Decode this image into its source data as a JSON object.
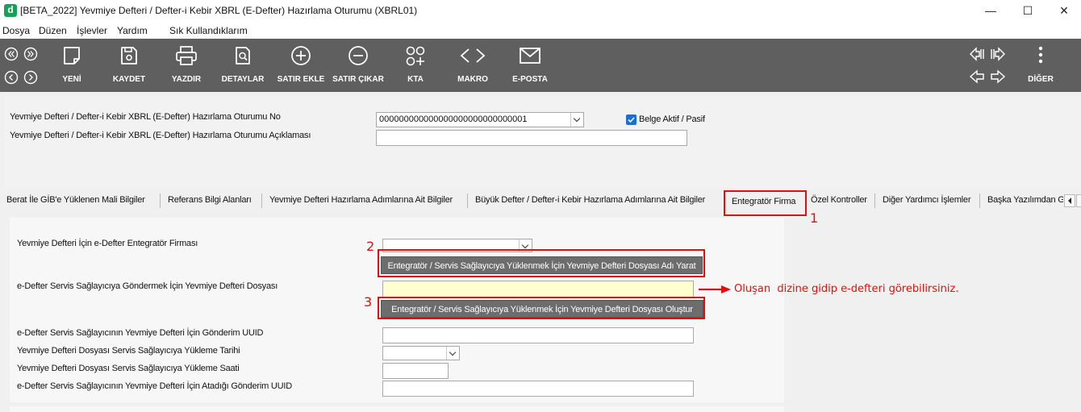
{
  "window": {
    "title": "[BETA_2022] Yevmiye Defteri / Defter-i Kebir XBRL (E-Defter) Hazırlama Oturumu (XBRL01)",
    "logo": "d",
    "minimize": "—",
    "maximize": "☐",
    "close": "✕"
  },
  "menu": {
    "items": [
      "Dosya",
      "Düzen",
      "İşlevler",
      "Yardım",
      "Sık Kullandıklarım"
    ]
  },
  "toolbar": {
    "buttons": [
      {
        "label": "YENİ",
        "icon": "new-document-icon"
      },
      {
        "label": "KAYDET",
        "icon": "save-icon"
      },
      {
        "label": "YAZDIR",
        "icon": "printer-icon"
      },
      {
        "label": "DETAYLAR",
        "icon": "details-icon"
      },
      {
        "label": "SATIR EKLE",
        "icon": "plus-circle-icon"
      },
      {
        "label": "SATIR ÇIKAR",
        "icon": "minus-circle-icon"
      },
      {
        "label": "KTA",
        "icon": "kta-icon"
      },
      {
        "label": "MAKRO",
        "icon": "code-icon"
      },
      {
        "label": "E-POSTA",
        "icon": "mail-icon"
      },
      {
        "label": "DİĞER",
        "icon": "more-vertical-icon"
      }
    ]
  },
  "header": {
    "session_no_label": "Yevmiye Defteri / Defter-i Kebir XBRL (E-Defter) Hazırlama Oturumu No",
    "session_no_value": "000000000000000000000000000001",
    "session_desc_label": "Yevmiye Defteri / Defter-i Kebir XBRL (E-Defter) Hazırlama Oturumu Açıklaması",
    "session_desc_value": "",
    "active_label": "Belge Aktif / Pasif",
    "active_checked": true
  },
  "tabs": [
    "Berat İle GİB'e Yüklenen Mali Bilgiler",
    "Referans Bilgi Alanları",
    "Yevmiye Defteri Hazırlama Adımlarına Ait Bilgiler",
    "Büyük Defter / Defter-i Kebir Hazırlama Adımlarına Ait Bilgiler",
    "Entegratör Firma",
    "Özel Kontroller",
    "Diğer Yardımcı İşlemler",
    "Başka Yazılımdan G"
  ],
  "active_tab": "Entegratör Firma",
  "form": {
    "integrator_label": "Yevmiye Defteri İçin e-Defter Entegratör Firması",
    "integrator_value": "",
    "create_name_button": "Entegratör / Servis Sağlayıcıya Yüklenmek İçin Yevmiye Defteri Dosyası Adı Yarat",
    "file_label": "e-Defter Servis Sağlayıcıya Göndermek İçin Yevmiye Defteri Dosyası",
    "file_value": "",
    "create_file_button": "Entegratör / Servis Sağlayıcıya Yüklenmek İçin Yevmiye Defteri Dosyası Oluştur",
    "uuid_label": "e-Defter Servis Sağlayıcının Yevmiye Defteri İçin Gönderim UUID",
    "uuid_value": "",
    "upload_date_label": "Yevmiye Defteri Dosyası Servis Sağlayıcıya Yükleme Tarihi",
    "upload_date_value": "",
    "upload_time_label": "Yevmiye Defteri Dosyası Servis Sağlayıcıya Yükleme Saati",
    "upload_time_value": "",
    "assigned_uuid_label": "e-Defter Servis Sağlayıcının Yevmiye Defteri İçin Atadığı Gönderim UUID",
    "assigned_uuid_value": ""
  },
  "annotations": {
    "n1": "1",
    "n2": "2",
    "n3": "3",
    "note": "Oluşan  dizine gidip e-defteri görebilirsiniz.",
    "color": "#e01010"
  }
}
